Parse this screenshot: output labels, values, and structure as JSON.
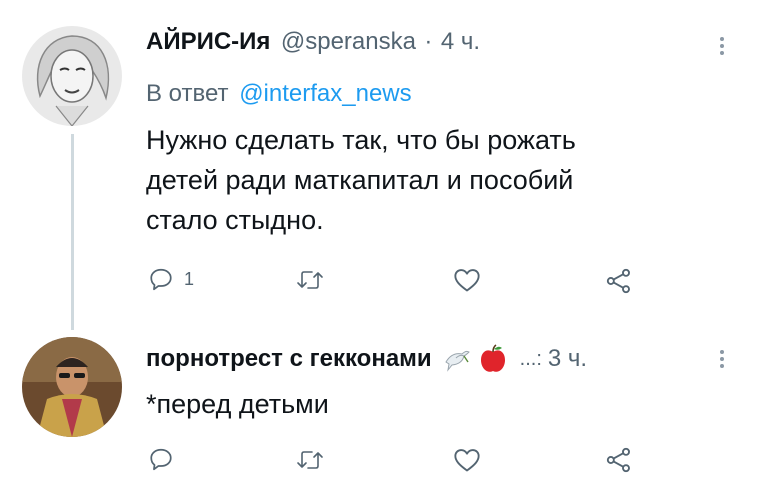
{
  "tweets": [
    {
      "display_name": "АЙРИС-Ия",
      "handle": "@speranska",
      "separator": "·",
      "time": "4 ч.",
      "reply_prefix": "В ответ",
      "reply_to": "@interfax_news",
      "text_lines": [
        "Нужно сделать так, что бы рожать",
        "детей ради маткапитал и пособий",
        "стало стыдно."
      ],
      "actions": {
        "reply_count": "1",
        "retweet_count": "",
        "like_count": ""
      },
      "avatar_icon": "woman-portrait-avatar"
    },
    {
      "display_name": "порнотрест с гекконами",
      "emoji": [
        "dove-icon",
        "apple-icon"
      ],
      "truncation": "...:",
      "time": "3 ч.",
      "text_lines": [
        "*перед детьми"
      ],
      "actions": {
        "reply_count": "",
        "retweet_count": "",
        "like_count": ""
      },
      "avatar_icon": "man-portrait-avatar"
    }
  ],
  "colors": {
    "accent": "#1d9bf0",
    "secondary_text": "#536471",
    "thread_line": "#cfd9de",
    "apple": "#e0242b"
  }
}
